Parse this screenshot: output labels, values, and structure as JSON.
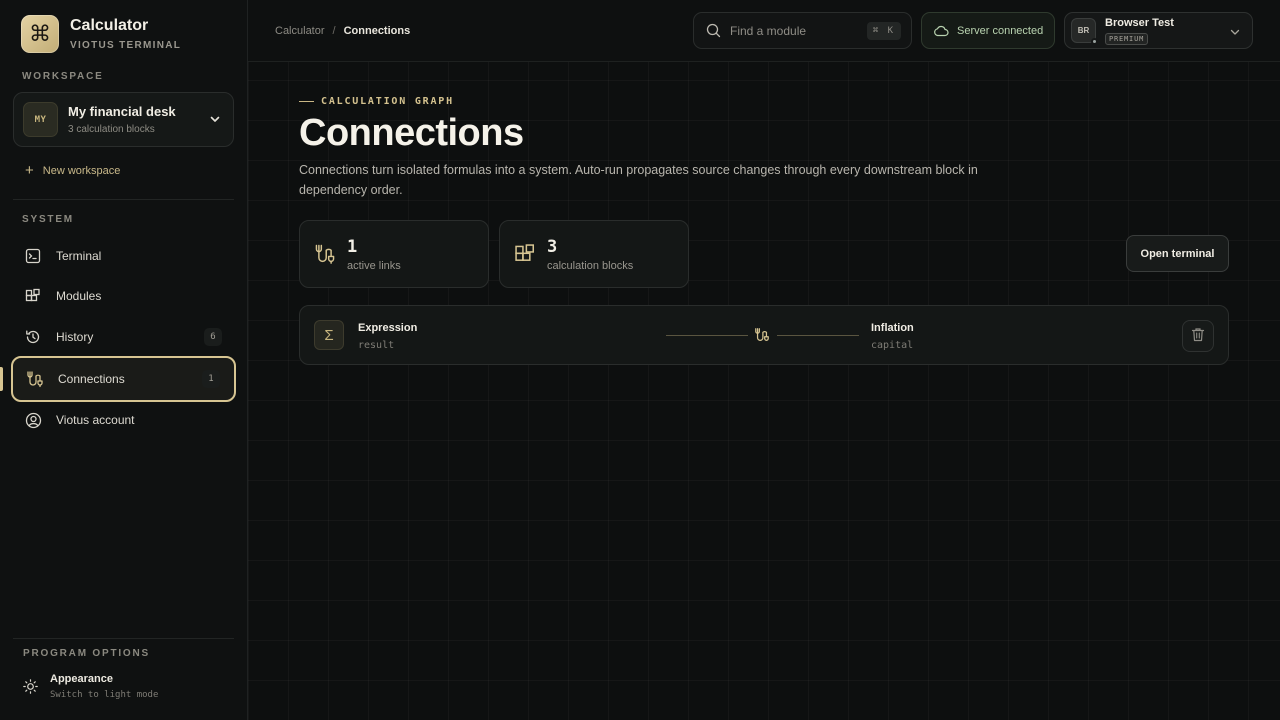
{
  "app": {
    "title": "Calculator",
    "subtitle": "VIOTUS TERMINAL",
    "logo_glyph": "⌘"
  },
  "sidebar": {
    "workspace_label": "WORKSPACE",
    "workspace": {
      "avatar": "MY",
      "name": "My financial desk",
      "count": "3 calculation blocks"
    },
    "new_workspace": "New workspace",
    "system_label": "SYSTEM",
    "items": [
      {
        "label": "Terminal",
        "icon": "terminal-icon",
        "badge": ""
      },
      {
        "label": "Modules",
        "icon": "modules-icon",
        "badge": ""
      },
      {
        "label": "History",
        "icon": "history-icon",
        "badge": "6"
      },
      {
        "label": "Connections",
        "icon": "connections-icon",
        "badge": "1",
        "active": true
      },
      {
        "label": "Viotus account",
        "icon": "account-icon",
        "badge": ""
      }
    ],
    "program_options_label": "PROGRAM OPTIONS",
    "appearance": {
      "title": "Appearance",
      "subtitle": "Switch to light mode"
    }
  },
  "topbar": {
    "breadcrumb": [
      "Calculator",
      "Connections"
    ],
    "breadcrumb_sep": "/",
    "search_placeholder": "Find a module",
    "search_shortcut": "⌘ K",
    "server_status": "Server connected",
    "user": {
      "initials": "BR",
      "name": "Browser Test",
      "plan": "PREMIUM"
    }
  },
  "page": {
    "eyebrow": "CALCULATION GRAPH",
    "title": "Connections",
    "description": "Connections turn isolated formulas into a system. Auto-run propagates source changes through every downstream block in dependency order.",
    "stats": [
      {
        "value": "1",
        "label": "active links",
        "icon": "link-icon"
      },
      {
        "value": "3",
        "label": "calculation blocks",
        "icon": "blocks-icon"
      }
    ],
    "open_terminal": "Open terminal",
    "connections": [
      {
        "source_name": "Expression",
        "source_var": "result",
        "target_name": "Inflation",
        "target_var": "capital"
      }
    ]
  },
  "colors": {
    "accent": "#d7c592",
    "background": "#0d0f0f",
    "server_ok": "#b9d3b0"
  }
}
